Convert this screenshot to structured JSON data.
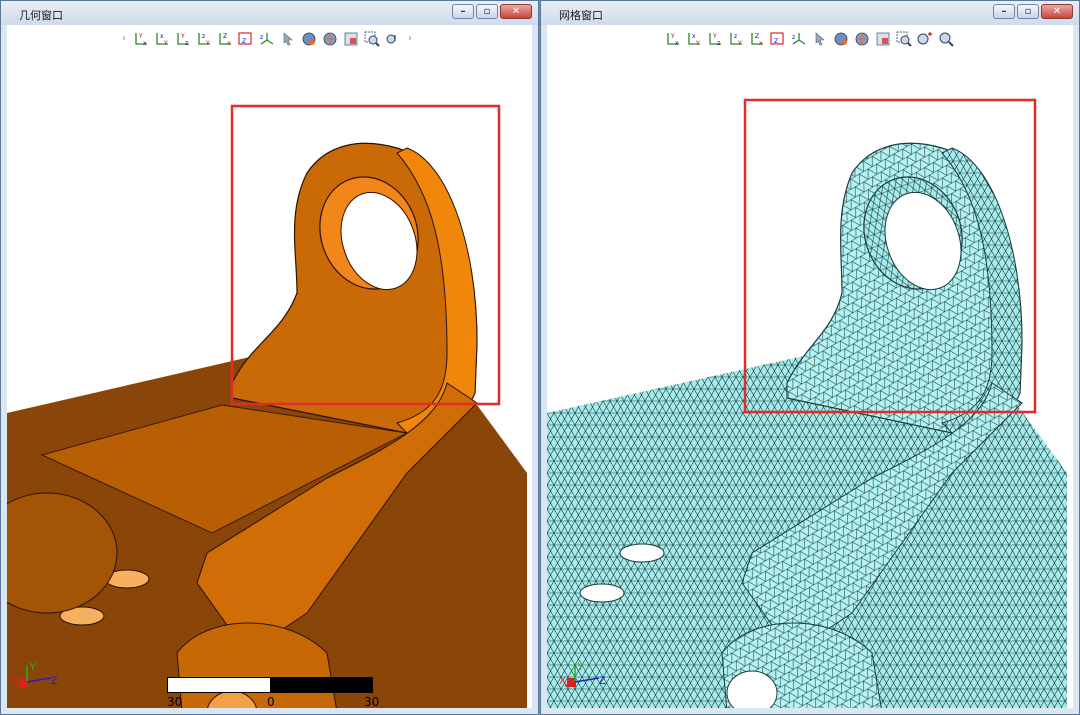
{
  "left_window": {
    "title": "几何窗口",
    "scale": {
      "left_label": "30",
      "middle_label": "0",
      "right_label": "30"
    },
    "triad": {
      "x": "X",
      "y": "Y",
      "z": "Z"
    }
  },
  "right_window": {
    "title": "网格窗口",
    "triad": {
      "x": "X",
      "y": "Y",
      "z": "Z"
    }
  },
  "toolbar_icons": [
    "view-yx-icon",
    "view-xy-icon",
    "view-yz-icon",
    "view-zy-icon",
    "view-zx-icon",
    "view-xz-icon",
    "view-iso-icon",
    "select-arrow-icon",
    "render-shaded-icon",
    "render-mesh-icon",
    "fit-icon",
    "zoom-box-icon",
    "zoom-in-icon",
    "zoom-fit-icon"
  ],
  "colors": {
    "geometry": "#cc6a06",
    "mesh": "#a6ecec",
    "highlight_box": "#e32b2b",
    "window_frame": "#5b7798"
  }
}
